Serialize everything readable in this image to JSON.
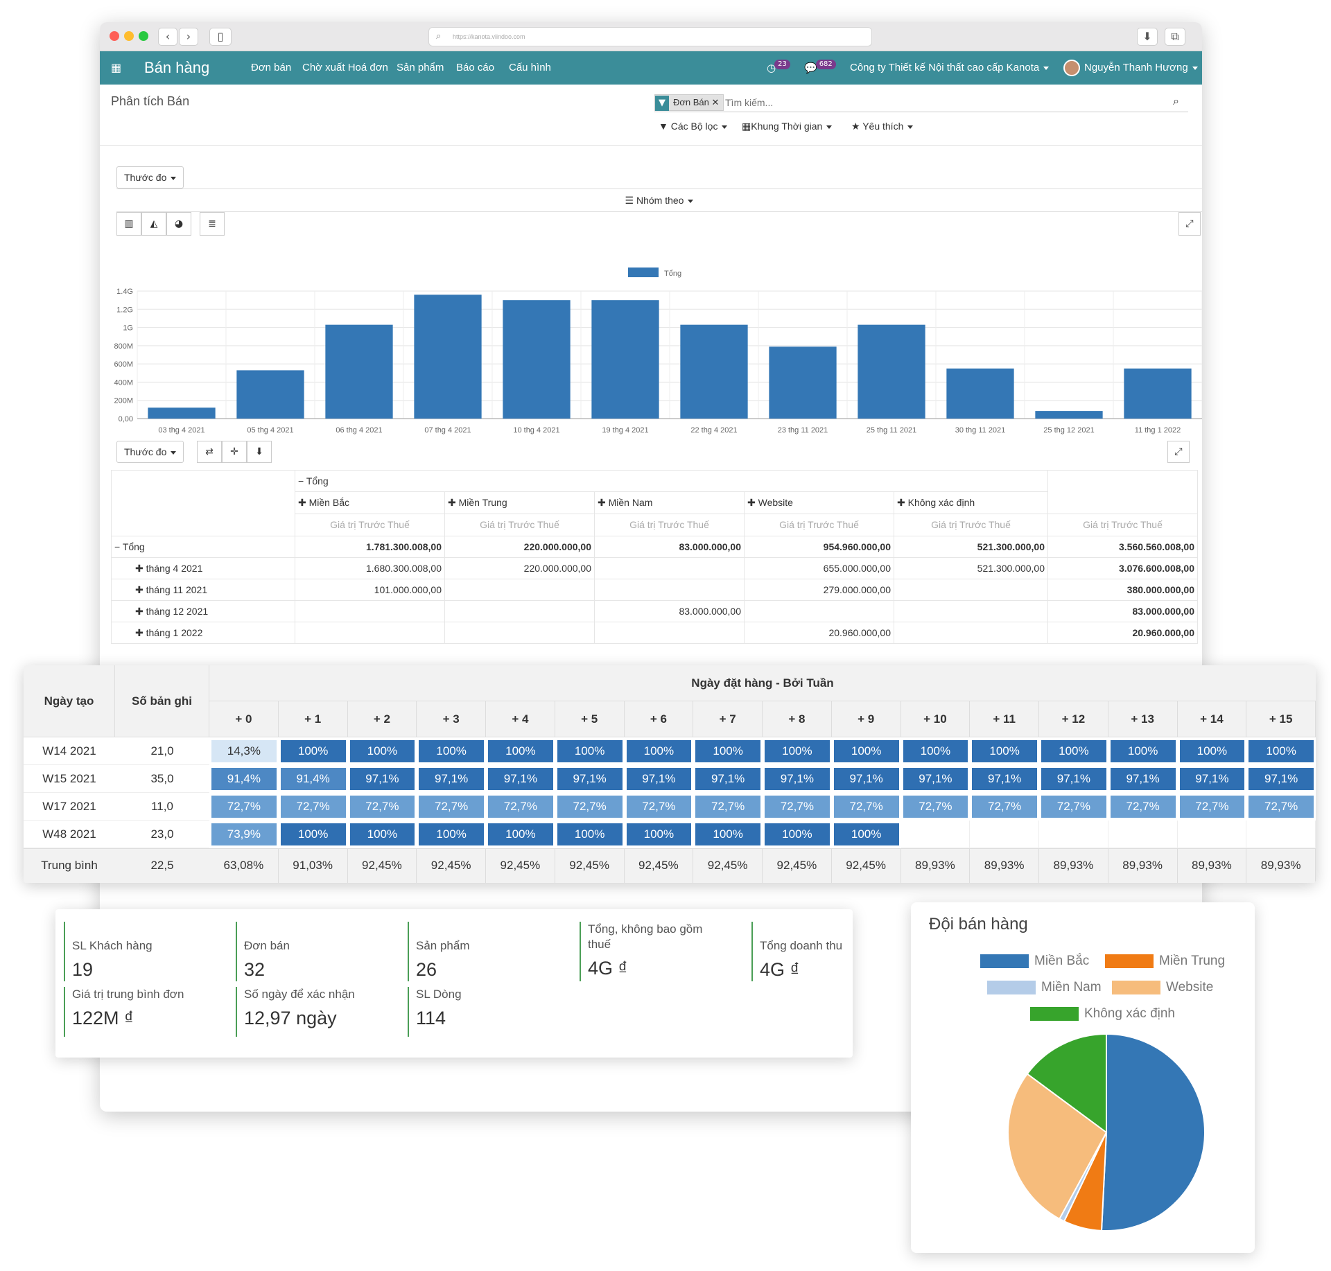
{
  "browser": {
    "url": "https://kanota.viindoo.com"
  },
  "navbar": {
    "app_title": "Bán hàng",
    "menu": [
      "Đơn bán",
      "Chờ xuất Hoá đơn",
      "Sản phẩm",
      "Báo cáo",
      "Cấu hình"
    ],
    "activity_count": "23",
    "message_count": "682",
    "company": "Công ty Thiết kế Nội thất cao cấp Kanota",
    "user": "Nguyễn Thanh Hương"
  },
  "control_panel": {
    "breadcrumb": "Phân tích Bán",
    "facet": "Đơn Bán",
    "search_placeholder": "Tìm kiếm...",
    "filters": "Các Bộ lọc",
    "time_range": "Khung Thời gian",
    "favorites": "Yêu thích"
  },
  "graph_view": {
    "measure": "Thước đo",
    "group_by": "Nhóm theo"
  },
  "chart_data": {
    "type": "bar",
    "legend": "Tổng",
    "categories": [
      "03 thg 4 2021",
      "05 thg 4 2021",
      "06 thg 4 2021",
      "07 thg 4 2021",
      "10 thg 4 2021",
      "19 thg 4 2021",
      "22 thg 4 2021",
      "23 thg 11 2021",
      "25 thg 11 2021",
      "30 thg 11 2021",
      "25 thg 12 2021",
      "11 thg 1 2022"
    ],
    "values": [
      120000000,
      530000000,
      1030000000,
      1360000000,
      1300000000,
      1300000000,
      1030000000,
      790000000,
      1030000000,
      550000000,
      83000000,
      550000000
    ],
    "y_ticks": [
      "0,00",
      "200M",
      "400M",
      "600M",
      "800M",
      "1G",
      "1.2G",
      "1.4G"
    ],
    "ylim": [
      0,
      1400000000
    ],
    "color": "#3477b5"
  },
  "pivot": {
    "measure": "Thước đo",
    "total": "Tổng",
    "columns": [
      "Miền Bắc",
      "Miền Trung",
      "Miền Nam",
      "Website",
      "Không xác định"
    ],
    "measure_label": "Giá trị Trước Thuế",
    "rows": [
      {
        "label": "Tổng",
        "cells": [
          "1.781.300.008,00",
          "220.000.000,00",
          "83.000.000,00",
          "954.960.000,00",
          "521.300.000,00",
          "3.560.560.008,00"
        ]
      },
      {
        "label": "tháng 4 2021",
        "cells": [
          "1.680.300.008,00",
          "220.000.000,00",
          "",
          "655.000.000,00",
          "521.300.000,00",
          "3.076.600.008,00"
        ]
      },
      {
        "label": "tháng 11 2021",
        "cells": [
          "101.000.000,00",
          "",
          "",
          "279.000.000,00",
          "",
          "380.000.000,00"
        ]
      },
      {
        "label": "tháng 12 2021",
        "cells": [
          "",
          "",
          "83.000.000,00",
          "",
          "",
          "83.000.000,00"
        ]
      },
      {
        "label": "tháng 1 2022",
        "cells": [
          "",
          "",
          "",
          "20.960.000,00",
          "",
          "20.960.000,00"
        ]
      }
    ]
  },
  "cohort": {
    "col_date": "Ngày tạo",
    "col_count": "Số bản ghi",
    "title": "Ngày đặt hàng - Bởi Tuần",
    "periods": [
      "+ 0",
      "+ 1",
      "+ 2",
      "+ 3",
      "+ 4",
      "+ 5",
      "+ 6",
      "+ 7",
      "+ 8",
      "+ 9",
      "+ 10",
      "+ 11",
      "+ 12",
      "+ 13",
      "+ 14",
      "+ 15"
    ],
    "rows": [
      {
        "label": "W14 2021",
        "count": "21,0",
        "cells": [
          "14,3%",
          "100%",
          "100%",
          "100%",
          "100%",
          "100%",
          "100%",
          "100%",
          "100%",
          "100%",
          "100%",
          "100%",
          "100%",
          "100%",
          "100%",
          "100%"
        ]
      },
      {
        "label": "W15 2021",
        "count": "35,0",
        "cells": [
          "91,4%",
          "91,4%",
          "97,1%",
          "97,1%",
          "97,1%",
          "97,1%",
          "97,1%",
          "97,1%",
          "97,1%",
          "97,1%",
          "97,1%",
          "97,1%",
          "97,1%",
          "97,1%",
          "97,1%",
          "97,1%"
        ]
      },
      {
        "label": "W17 2021",
        "count": "11,0",
        "cells": [
          "72,7%",
          "72,7%",
          "72,7%",
          "72,7%",
          "72,7%",
          "72,7%",
          "72,7%",
          "72,7%",
          "72,7%",
          "72,7%",
          "72,7%",
          "72,7%",
          "72,7%",
          "72,7%",
          "72,7%",
          "72,7%"
        ]
      },
      {
        "label": "W48 2021",
        "count": "23,0",
        "cells": [
          "73,9%",
          "100%",
          "100%",
          "100%",
          "100%",
          "100%",
          "100%",
          "100%",
          "100%",
          "100%",
          "",
          "",
          "",
          "",
          "",
          ""
        ]
      }
    ],
    "average": {
      "label": "Trung bình",
      "count": "22,5",
      "cells": [
        "63,08%",
        "91,03%",
        "92,45%",
        "92,45%",
        "92,45%",
        "92,45%",
        "92,45%",
        "92,45%",
        "92,45%",
        "92,45%",
        "89,93%",
        "89,93%",
        "89,93%",
        "89,93%",
        "89,93%",
        "89,93%"
      ]
    }
  },
  "kpis": [
    {
      "label": "SL Khách hàng",
      "value": "19"
    },
    {
      "label": "Đơn bán",
      "value": "32"
    },
    {
      "label": "Sản phẩm",
      "value": "26"
    },
    {
      "label": "Tổng, không bao gồm thuế",
      "value": "4G ₫"
    },
    {
      "label": "Tổng doanh thu",
      "value": "4G ₫"
    },
    {
      "label": "Giá trị trung bình đơn",
      "value": "122M ₫"
    },
    {
      "label": "Số ngày để xác nhận",
      "value": "12,97 ngày"
    },
    {
      "label": "SL Dòng",
      "value": "114"
    }
  ],
  "pie": {
    "title": "Đội bán hàng",
    "type": "pie",
    "slices": [
      {
        "name": "Miền Bắc",
        "value": 1781300008,
        "color": "#3477b5"
      },
      {
        "name": "Miền Trung",
        "value": 220000000,
        "color": "#f07b14"
      },
      {
        "name": "Miền Nam",
        "value": 30000000,
        "color": "#b4cce8"
      },
      {
        "name": "Website",
        "value": 954960000,
        "color": "#f6bc7c"
      },
      {
        "name": "Không xác định",
        "value": 521300000,
        "color": "#37a42c"
      }
    ]
  }
}
